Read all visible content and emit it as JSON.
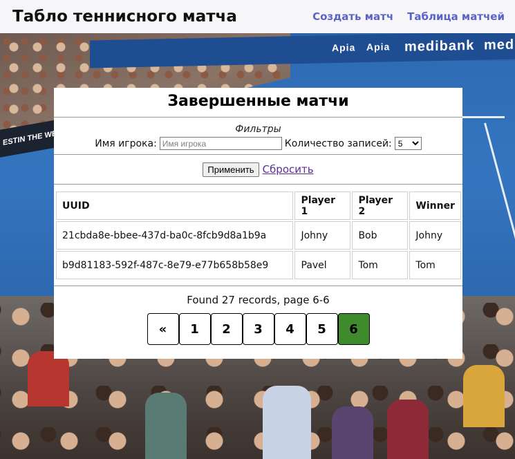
{
  "header": {
    "title": "Табло теннисного матча",
    "nav": [
      "Создать матч",
      "Таблица матчей"
    ]
  },
  "panel": {
    "title": "Завершенные матчи",
    "filters": {
      "caption": "Фильтры",
      "player_label": "Имя игрока:",
      "player_placeholder": "Имя игрока",
      "player_value": "",
      "count_label": "Количество записей:",
      "count_value": "5"
    },
    "apply_label": "Применить",
    "reset_label": "Сбросить"
  },
  "table": {
    "headers": [
      "UUID",
      "Player 1",
      "Player 2",
      "Winner"
    ],
    "rows": [
      [
        "21cbda8e-bbee-437d-ba0c-8fcb9d8a1b9a",
        "Johny",
        "Bob",
        "Johny"
      ],
      [
        "b9d81183-592f-487c-8e79-e77b658b58e9",
        "Pavel",
        "Tom",
        "Tom"
      ]
    ]
  },
  "pagination": {
    "summary": "Found 27 records, page 6-6",
    "prev_label": "«",
    "pages": [
      "1",
      "2",
      "3",
      "4",
      "5",
      "6"
    ],
    "current": "6"
  },
  "background": {
    "banner_text": [
      "Apia",
      "Apia",
      "medibank",
      "medi"
    ],
    "side_banner_text": "ESTIN THE WES"
  },
  "colors": {
    "nav_link": "#5a63c8",
    "active_page": "#3f8a2c",
    "reset_link": "#5b2d9a",
    "court": "#2f6cb6"
  }
}
